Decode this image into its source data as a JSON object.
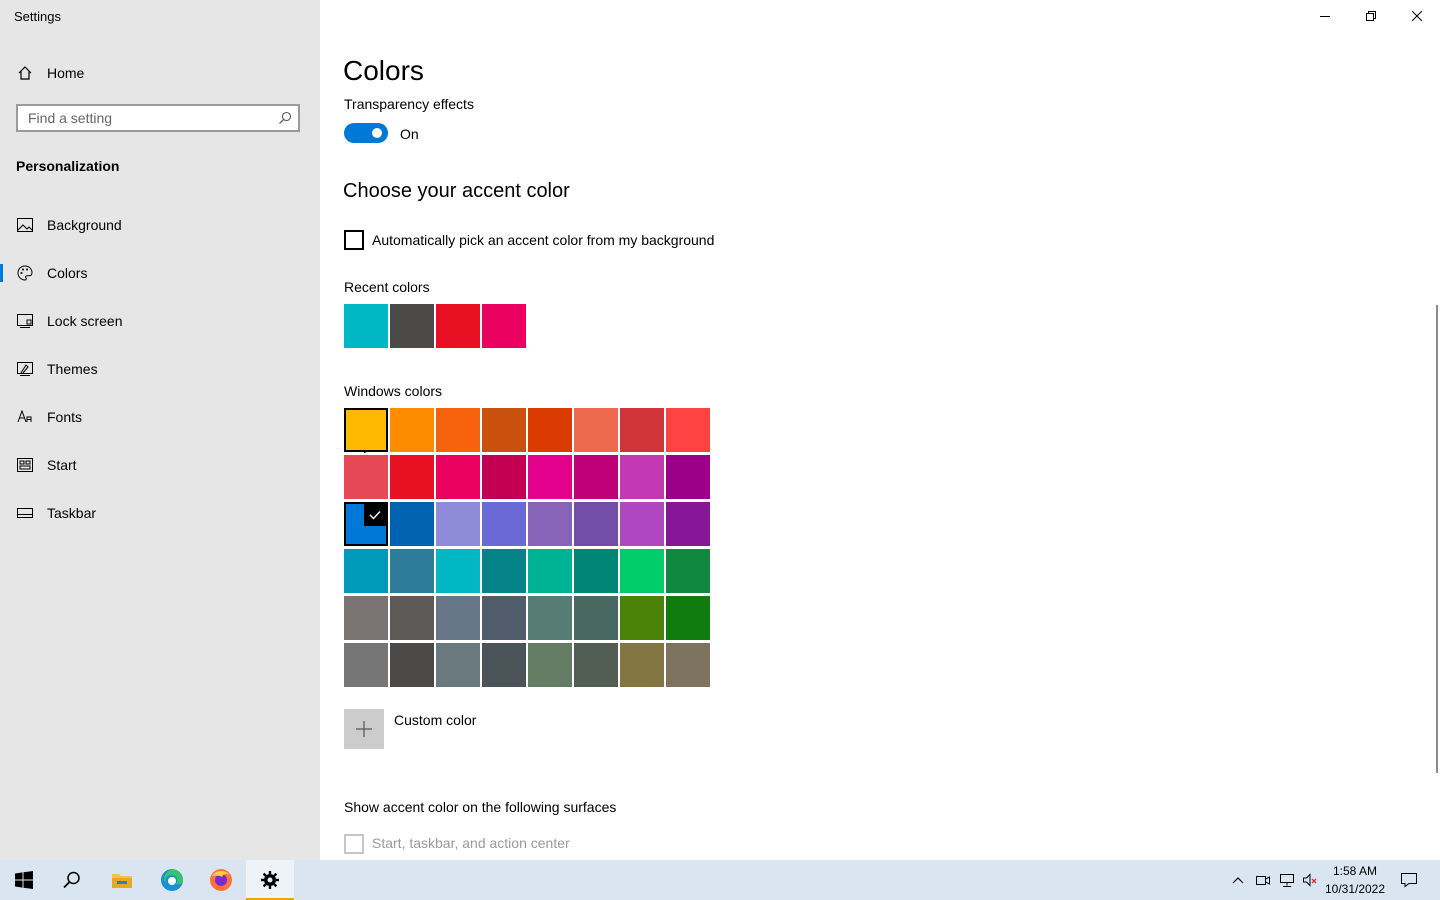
{
  "window": {
    "title": "Settings"
  },
  "sidebar": {
    "home_label": "Home",
    "search_placeholder": "Find a setting",
    "section_title": "Personalization",
    "items": [
      {
        "label": "Background",
        "icon": "picture-icon"
      },
      {
        "label": "Colors",
        "icon": "palette-icon",
        "active": true
      },
      {
        "label": "Lock screen",
        "icon": "lock-screen-icon"
      },
      {
        "label": "Themes",
        "icon": "themes-icon"
      },
      {
        "label": "Fonts",
        "icon": "font-icon"
      },
      {
        "label": "Start",
        "icon": "start-layout-icon"
      },
      {
        "label": "Taskbar",
        "icon": "taskbar-icon"
      }
    ]
  },
  "main": {
    "title": "Colors",
    "transparency": {
      "label": "Transparency effects",
      "state": "On",
      "on": true
    },
    "accent_heading": "Choose your accent color",
    "auto_pick_label": "Automatically pick an accent color from my background",
    "recent_label": "Recent colors",
    "recent_colors": [
      "#00b7c3",
      "#4c4a48",
      "#e81123",
      "#ea005e"
    ],
    "windows_label": "Windows colors",
    "windows_colors": [
      [
        "#ffb900",
        "#ff8c00",
        "#f7630c",
        "#ca5010",
        "#da3b01",
        "#ef6950",
        "#d13438",
        "#ff4343"
      ],
      [
        "#e74856",
        "#e81123",
        "#ea005e",
        "#c30052",
        "#e3008c",
        "#bf0077",
        "#c239b3",
        "#9a0089"
      ],
      [
        "#0078d7",
        "#0063b1",
        "#8e8cd8",
        "#6b69d6",
        "#8764b8",
        "#744da9",
        "#b146c2",
        "#881798"
      ],
      [
        "#0099bc",
        "#2d7d9a",
        "#00b7c3",
        "#038387",
        "#00b294",
        "#018574",
        "#00cc6a",
        "#10893e"
      ],
      [
        "#7a7574",
        "#5d5a58",
        "#68768a",
        "#515c6b",
        "#567c73",
        "#486860",
        "#498205",
        "#107c10"
      ],
      [
        "#767676",
        "#4c4a48",
        "#69797e",
        "#4a5459",
        "#647c64",
        "#525e54",
        "#847545",
        "#7e735f"
      ]
    ],
    "selected_color": "#0078d7",
    "custom_color_label": "Custom color",
    "surfaces_label": "Show accent color on the following surfaces",
    "surface_option": "Start, taskbar, and action center"
  },
  "taskbar": {
    "time": "1:58 AM",
    "date": "10/31/2022"
  }
}
